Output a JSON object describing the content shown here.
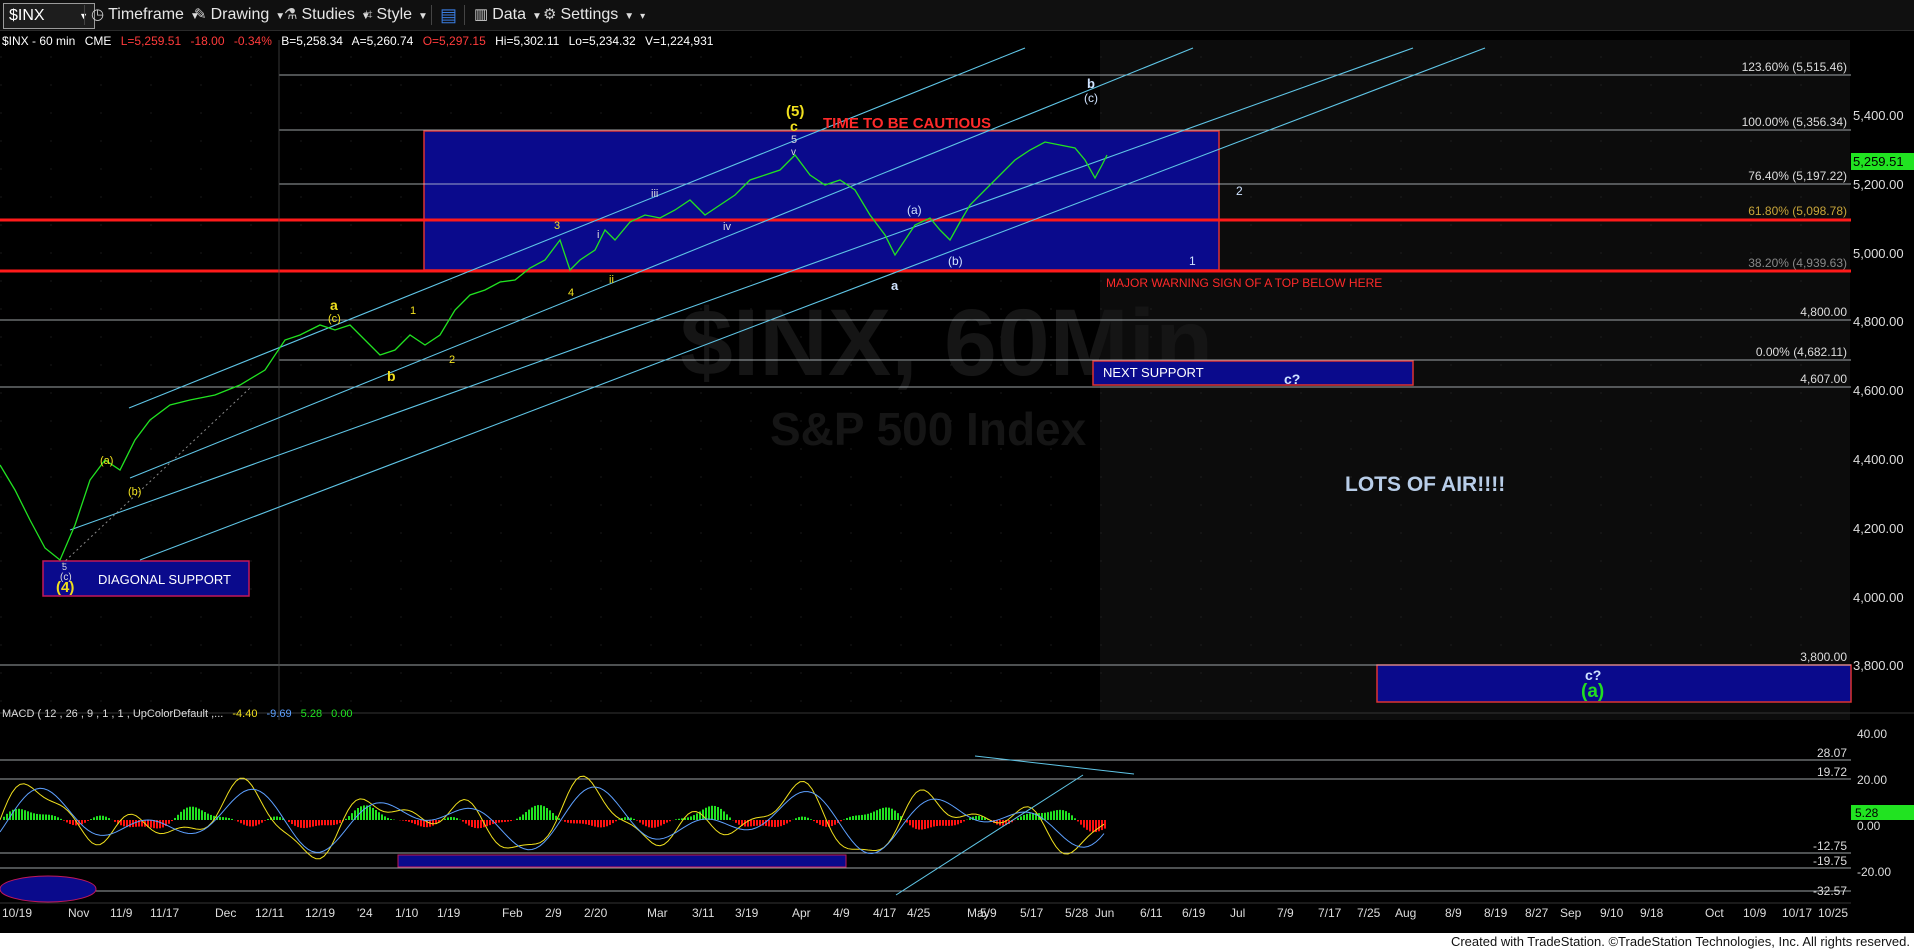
{
  "toolbar": {
    "symbol": "$INX",
    "timeframe": "Timeframe",
    "drawing": "Drawing",
    "studies": "Studies",
    "style": "Style",
    "data": "Data",
    "settings": "Settings",
    "icons": [
      "timeframe-icon",
      "drawing-icon",
      "studies-icon",
      "style-icon",
      "layout-icon",
      "data-icon",
      "settings-icon"
    ]
  },
  "quote": {
    "symbol": "$INX - 60 min",
    "exchange": "CME",
    "last": "L=5,259.51",
    "change": "-18.00",
    "pct": "-0.34%",
    "bid": "B=5,258.34",
    "ask": "A=5,260.74",
    "open": "O=5,297.15",
    "high": "Hi=5,302.11",
    "low": "Lo=5,234.32",
    "volume": "V=1,224,931"
  },
  "watermark": {
    "line1": "$INX, 60Min",
    "line2": "S&P 500 Index"
  },
  "price_axis": {
    "ticks": [
      "5,400.00",
      "5,200.00",
      "5,000.00",
      "4,800.00",
      "4,600.00",
      "4,400.00",
      "4,200.00",
      "4,000.00",
      "3,800.00"
    ],
    "current": "5,259.51"
  },
  "fib_labels": [
    "123.60% (5,515.46)",
    "100.00% (5,356.34)",
    "76.40% (5,197.22)",
    "61.80% (5,098.78)",
    "38.20% (4,939.63)",
    "0.00% (4,682.11)"
  ],
  "level_labels": [
    "4,800.00",
    "4,607.00",
    "3,800.00"
  ],
  "annotations": {
    "cautious": "TIME TO BE CAUTIOUS",
    "warning": "MAJOR WARNING SIGN OF A TOP BELOW HERE",
    "next_support": "NEXT SUPPORT",
    "diag_support": "DIAGONAL SUPPORT",
    "lots_of_air": "LOTS OF AIR!!!!",
    "c_q1": "c?",
    "c_q2": "c?",
    "a_green": "(a)"
  },
  "wave_labels": {
    "five": "(5)",
    "c_top": "c",
    "five_small": "5",
    "v": "v",
    "b": "b",
    "c_paren": "(c)",
    "two": "2",
    "one": "1",
    "a_paren": "(a)",
    "b_paren": "(b)",
    "a": "a",
    "three": "3",
    "iii": "iii",
    "iv": "iv",
    "i": "i",
    "ii": "ii",
    "four": "4",
    "a_yel": "a",
    "c_yel": "(c)",
    "b_yel": "b",
    "one_yel": "1",
    "two_yel": "2",
    "a_p_yel": "(a)",
    "b_p_yel": "(b)",
    "c_low": "(c)",
    "four_low": "(4)",
    "five_low": "5"
  },
  "macd": {
    "title": "MACD ( 12 , 26 , 9 , 1 , 1 , UpColorDefault ,...",
    "v1": "-4.40",
    "v2": "-9.69",
    "v3": "5.28",
    "v4": "0.00",
    "axis": [
      "40.00",
      "20.00",
      "0.00",
      "-20.00"
    ],
    "levels": [
      "28.07",
      "19.72",
      "-12.75",
      "-19.75",
      "-32.57"
    ],
    "current": "5.28"
  },
  "date_axis": [
    "10/19",
    "Nov",
    "11/9",
    "11/17",
    "Dec",
    "12/11",
    "12/19",
    "'24",
    "1/10",
    "1/19",
    "Feb",
    "2/9",
    "2/20",
    "Mar",
    "3/11",
    "3/19",
    "Apr",
    "4/9",
    "4/17",
    "4/25",
    "May",
    "5/9",
    "5/17",
    "5/28",
    "Jun",
    "6/11",
    "6/19",
    "Jul",
    "7/9",
    "7/17",
    "7/25",
    "Aug",
    "8/9",
    "8/19",
    "8/27",
    "Sep",
    "9/10",
    "9/18",
    "Oct",
    "10/9",
    "10/17",
    "10/25"
  ],
  "footer": "Created with TradeStation. ©TradeStation Technologies, Inc. All rights reserved.",
  "colors": {
    "up": "#21e321",
    "down": "#ff1111",
    "fib": "#5fc5e6",
    "box": "#0a0a8c",
    "yellow": "#f0e01e"
  }
}
